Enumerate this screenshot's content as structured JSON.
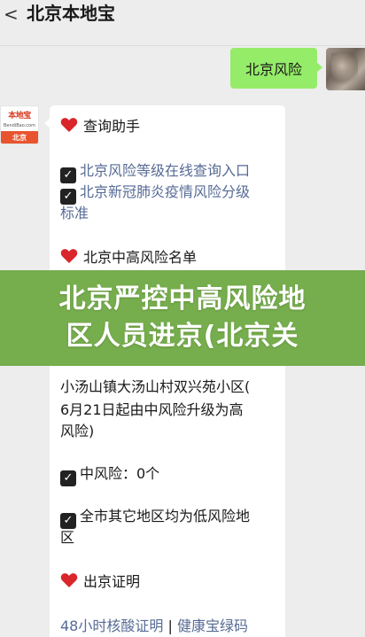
{
  "header": {
    "back_glyph": "<",
    "title": "北京本地宝"
  },
  "user_message": {
    "text": "北京风险"
  },
  "bot": {
    "avatar": {
      "brand": "本地宝",
      "domain": "BendiBao.com",
      "city": "北京"
    },
    "lines": {
      "l1": "查询助手",
      "l2": "北京风险等级在线查询入口",
      "l3a": "北京新冠肺炎疫情风险分级",
      "l3b": "标准",
      "l4": "北京中高风险名单",
      "l5a": "小汤山镇大汤山村双兴苑小区(",
      "l5b": "6月21日起由中风险升级为高",
      "l5c": "风险)",
      "l6": "中风险：0个",
      "l7a": "全市其它地区均为低风险地",
      "l7b": "区",
      "l8": "出京证明",
      "l9a": "48小时核酸证明",
      "l9sep": "|",
      "l9b": "健康宝绿码"
    }
  },
  "banner": {
    "line1": "北京严控中高风险地",
    "line2": "区人员进京(北京关"
  },
  "colors": {
    "chat_bg": "#ededed",
    "user_bubble": "#95ec69",
    "link": "#576b95",
    "banner": "#76ad4d",
    "heart": "#d9262b"
  }
}
